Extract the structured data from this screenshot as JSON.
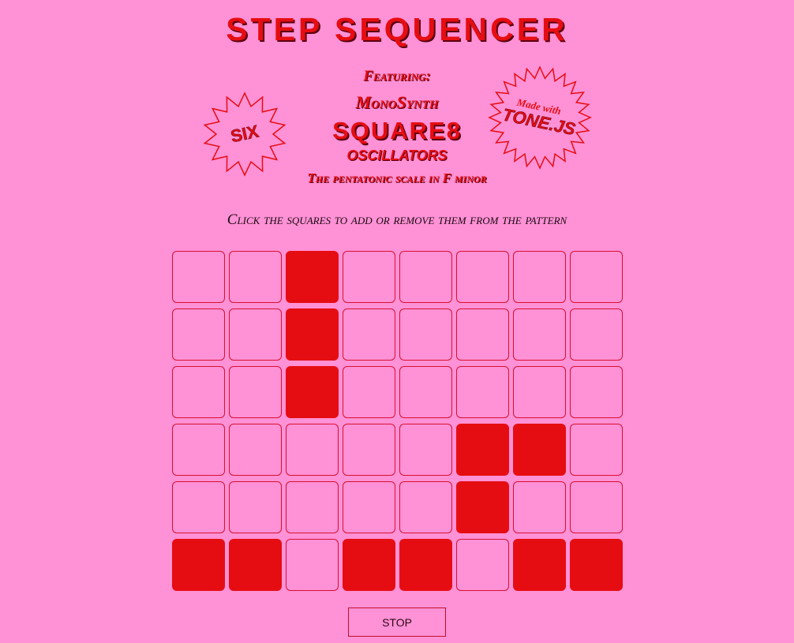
{
  "header": {
    "title": "STEP SEQUENCER",
    "featuring": "Featuring:",
    "synth": "MonoSynth",
    "oscillator_type": "SQUARE8",
    "oscillators": "OSCILLATORS",
    "scale": "The pentatonic scale in F minor"
  },
  "badges": {
    "left": "SIX",
    "right_top": "Made with",
    "right_bottom": "TONE.JS"
  },
  "instruction": "Click the squares to add or remove them from the pattern",
  "sequencer": {
    "rows": 6,
    "columns": 8,
    "pattern": [
      [
        0,
        0,
        1,
        0,
        0,
        0,
        0,
        0
      ],
      [
        0,
        0,
        1,
        0,
        0,
        0,
        0,
        0
      ],
      [
        0,
        0,
        1,
        0,
        0,
        0,
        0,
        0
      ],
      [
        0,
        0,
        0,
        0,
        0,
        1,
        1,
        0
      ],
      [
        0,
        0,
        0,
        0,
        0,
        1,
        0,
        0
      ],
      [
        1,
        1,
        0,
        1,
        1,
        0,
        1,
        1
      ]
    ]
  },
  "controls": {
    "stop_label": "STOP"
  },
  "colors": {
    "background": "#ff91d6",
    "accent": "#e60d12"
  }
}
